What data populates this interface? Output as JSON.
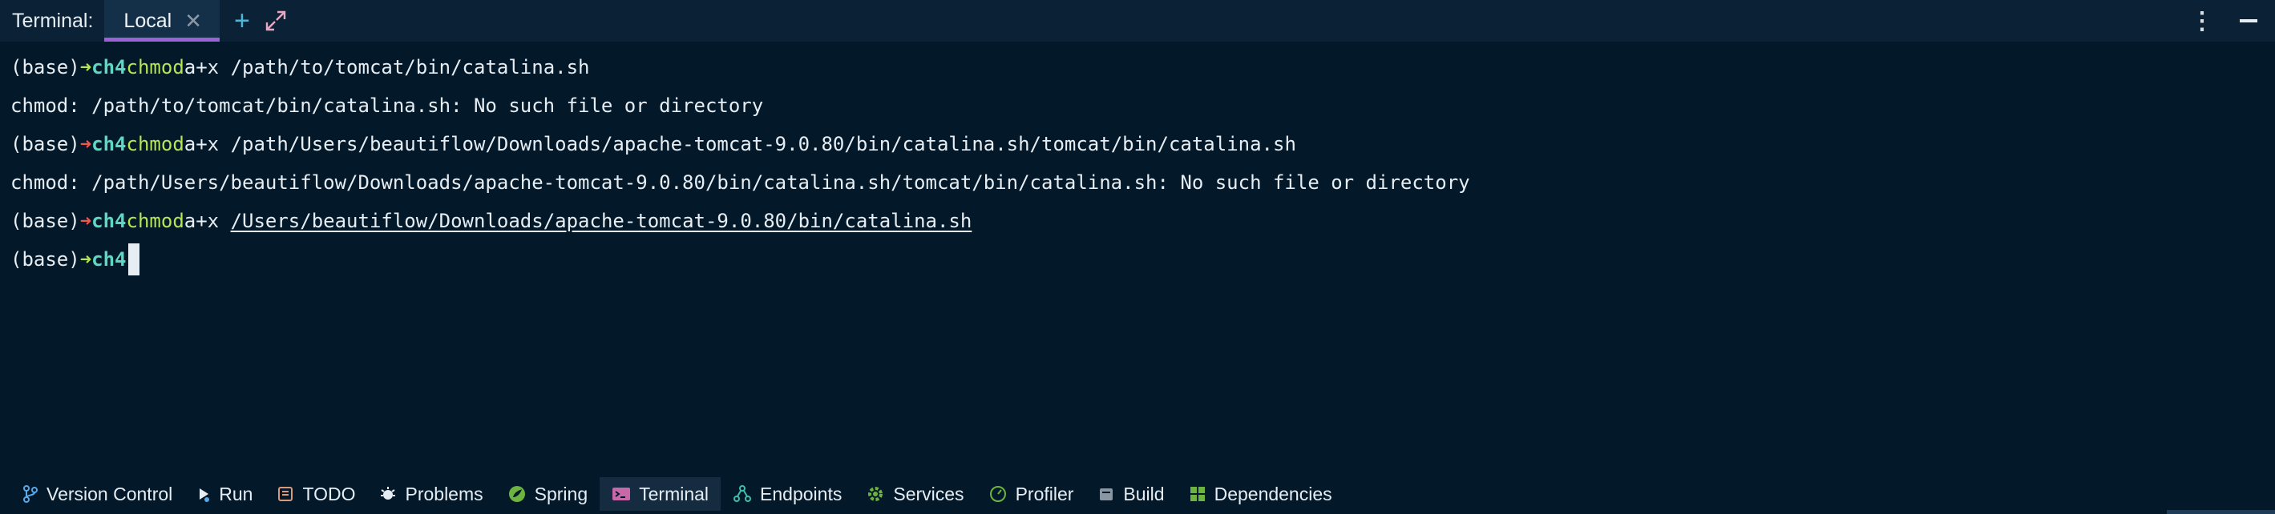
{
  "tabbar": {
    "title": "Terminal:",
    "tab_label": "Local",
    "close_glyph": "✕",
    "add_glyph": "+",
    "expand_icon": "expand-icon",
    "options_glyph": "⋮",
    "minimize_icon": "minimize-icon"
  },
  "terminal": {
    "lines": [
      {
        "prompt": "(base)",
        "arrow": "➜",
        "arrow_status": "success",
        "dir": "ch4",
        "command": "chmod",
        "args": "a+x /path/to/tomcat/bin/catalina.sh"
      },
      {
        "output": "chmod: /path/to/tomcat/bin/catalina.sh: No such file or directory"
      },
      {
        "prompt": "(base)",
        "arrow": "➜",
        "arrow_status": "error",
        "dir": "ch4",
        "command": "chmod",
        "args": "a+x /path/Users/beautiflow/Downloads/apache-tomcat-9.0.80/bin/catalina.sh/tomcat/bin/catalina.sh"
      },
      {
        "output": "chmod: /path/Users/beautiflow/Downloads/apache-tomcat-9.0.80/bin/catalina.sh/tomcat/bin/catalina.sh: No such file or directory"
      },
      {
        "prompt": "(base)",
        "arrow": "➜",
        "arrow_status": "error",
        "dir": "ch4",
        "command": "chmod",
        "args_prefix": "a+x ",
        "args_link": "/Users/beautiflow/Downloads/apache-tomcat-9.0.80/bin/catalina.sh"
      },
      {
        "prompt": "(base)",
        "arrow": "➜",
        "arrow_status": "success",
        "dir": "ch4"
      }
    ]
  },
  "bottom_bar": {
    "items": [
      {
        "label": "Version Control",
        "icon": "version-control-icon"
      },
      {
        "label": "Run",
        "icon": "run-icon"
      },
      {
        "label": "TODO",
        "icon": "todo-icon"
      },
      {
        "label": "Problems",
        "icon": "problems-icon"
      },
      {
        "label": "Spring",
        "icon": "spring-icon"
      },
      {
        "label": "Terminal",
        "icon": "terminal-icon",
        "active": true
      },
      {
        "label": "Endpoints",
        "icon": "endpoints-icon"
      },
      {
        "label": "Services",
        "icon": "services-icon"
      },
      {
        "label": "Profiler",
        "icon": "profiler-icon"
      },
      {
        "label": "Build",
        "icon": "build-icon"
      },
      {
        "label": "Dependencies",
        "icon": "dependencies-icon"
      }
    ]
  },
  "colors": {
    "background": "#03192a",
    "tabbar": "#0b2236",
    "tab_active": "#133048",
    "tab_underline": "#9b62d4",
    "prompt_success": "#b5e656",
    "prompt_error": "#f0564b",
    "directory": "#5fd8c2",
    "command": "#b5e656",
    "text": "#e6edf3"
  }
}
